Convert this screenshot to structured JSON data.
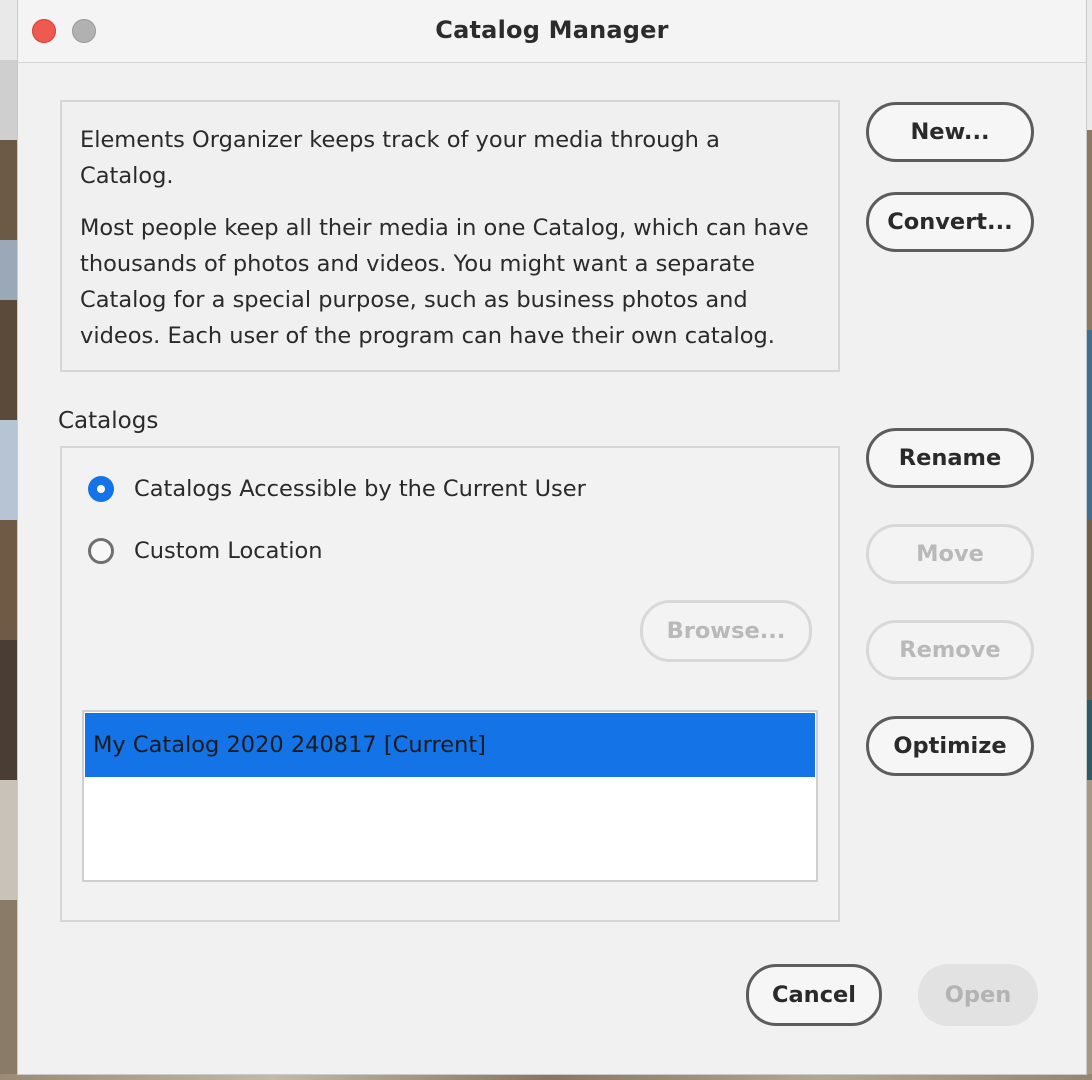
{
  "window": {
    "title": "Catalog Manager"
  },
  "info": {
    "paragraph1": "Elements Organizer keeps track of your media through a Catalog.",
    "paragraph2": "Most people keep all their media in one Catalog, which can have thousands of photos and videos. You might want a separate Catalog for a special purpose, such as business photos and videos. Each user of the program can have their own catalog."
  },
  "buttons": {
    "new": "New...",
    "convert": "Convert...",
    "rename": "Rename",
    "move": "Move",
    "remove": "Remove",
    "optimize": "Optimize",
    "browse": "Browse...",
    "cancel": "Cancel",
    "open": "Open"
  },
  "catalogs": {
    "label": "Catalogs",
    "options": [
      {
        "label": "Catalogs Accessible by the Current User",
        "selected": true
      },
      {
        "label": "Custom Location",
        "selected": false
      }
    ],
    "items": [
      {
        "label": "My Catalog 2020 240817 [Current]",
        "selected": true
      }
    ]
  },
  "colors": {
    "accent": "#1473e6",
    "close": "#ee5a52"
  }
}
